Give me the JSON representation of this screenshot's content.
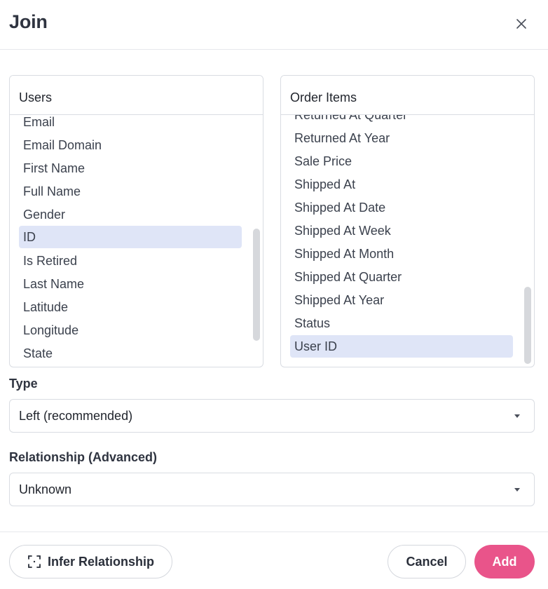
{
  "dialog": {
    "title": "Join",
    "close_icon": "close-icon"
  },
  "left_panel": {
    "title": "Users",
    "selected": "ID",
    "items": [
      "Email",
      "Email Domain",
      "First Name",
      "Full Name",
      "Gender",
      "ID",
      "Is Retired",
      "Last Name",
      "Latitude",
      "Longitude",
      "State"
    ]
  },
  "right_panel": {
    "title": "Order Items",
    "selected": "User ID",
    "items": [
      "Returned At Quarter",
      "Returned At Year",
      "Sale Price",
      "Shipped At",
      "Shipped At Date",
      "Shipped At Week",
      "Shipped At Month",
      "Shipped At Quarter",
      "Shipped At Year",
      "Status",
      "User ID"
    ]
  },
  "type_field": {
    "label": "Type",
    "value": "Left (recommended)"
  },
  "relationship_field": {
    "label": "Relationship (Advanced)",
    "value": "Unknown"
  },
  "footer": {
    "infer_label": "Infer Relationship",
    "infer_icon": "focus-frame-icon",
    "cancel_label": "Cancel",
    "add_label": "Add"
  },
  "colors": {
    "accent": "#e9548a",
    "selection": "#dfe5f7"
  }
}
